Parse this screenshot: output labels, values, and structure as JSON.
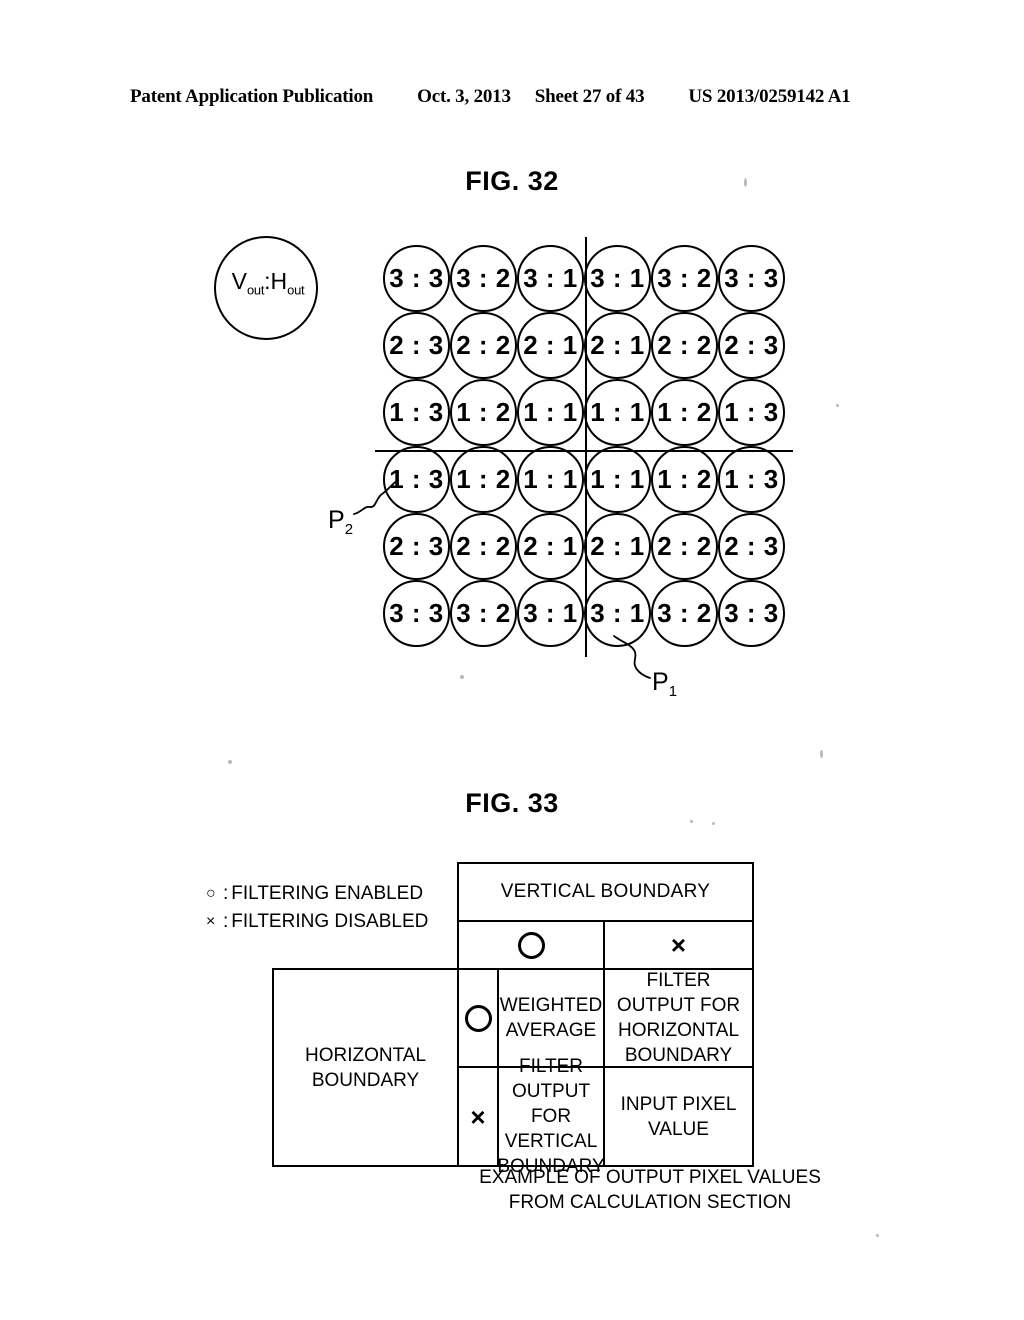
{
  "header": {
    "publication": "Patent Application Publication",
    "date": "Oct. 3, 2013",
    "sheet": "Sheet 27 of 43",
    "patent_number": "US 2013/0259142 A1"
  },
  "fig32": {
    "title": "FIG. 32",
    "legend_circle": {
      "v_main": "V",
      "v_sub": "out",
      "separator": ":",
      "h_main": "H",
      "h_sub": "out"
    },
    "label_p1": "P",
    "label_p1_sub": "1",
    "label_p2": "P",
    "label_p2_sub": "2",
    "grid": {
      "rows": 6,
      "cols": 6,
      "cells": [
        [
          "3 : 3",
          "3 : 2",
          "3 : 1",
          "3 : 1",
          "3 : 2",
          "3 : 3"
        ],
        [
          "2 : 3",
          "2 : 2",
          "2 : 1",
          "2 : 1",
          "2 : 2",
          "2 : 3"
        ],
        [
          "1 : 3",
          "1 : 2",
          "1 : 1",
          "1 : 1",
          "1 : 2",
          "1 : 3"
        ],
        [
          "1 : 3",
          "1 : 2",
          "1 : 1",
          "1 : 1",
          "1 : 2",
          "1 : 3"
        ],
        [
          "2 : 3",
          "2 : 2",
          "2 : 1",
          "2 : 1",
          "2 : 2",
          "2 : 3"
        ],
        [
          "3 : 3",
          "3 : 2",
          "3 : 1",
          "3 : 1",
          "3 : 2",
          "3 : 3"
        ]
      ]
    }
  },
  "fig33": {
    "title": "FIG. 33",
    "legend": {
      "enabled_symbol": "○",
      "enabled_sep": ":",
      "enabled_text": "FILTERING ENABLED",
      "disabled_symbol": "×",
      "disabled_sep": ":",
      "disabled_text": "FILTERING DISABLED"
    },
    "table": {
      "column_group_header": "VERTICAL BOUNDARY",
      "row_group_header": "HORIZONTAL BOUNDARY",
      "col_headers": [
        "○",
        "×"
      ],
      "row_headers": [
        "○",
        "×"
      ],
      "cells": [
        [
          "WEIGHTED AVERAGE",
          "FILTER OUTPUT FOR HORIZONTAL BOUNDARY"
        ],
        [
          "FILTER OUTPUT FOR VERTICAL BOUNDARY",
          "INPUT PIXEL VALUE"
        ]
      ]
    },
    "caption_line1": "EXAMPLE OF OUTPUT PIXEL VALUES",
    "caption_line2": "FROM CALCULATION SECTION"
  }
}
